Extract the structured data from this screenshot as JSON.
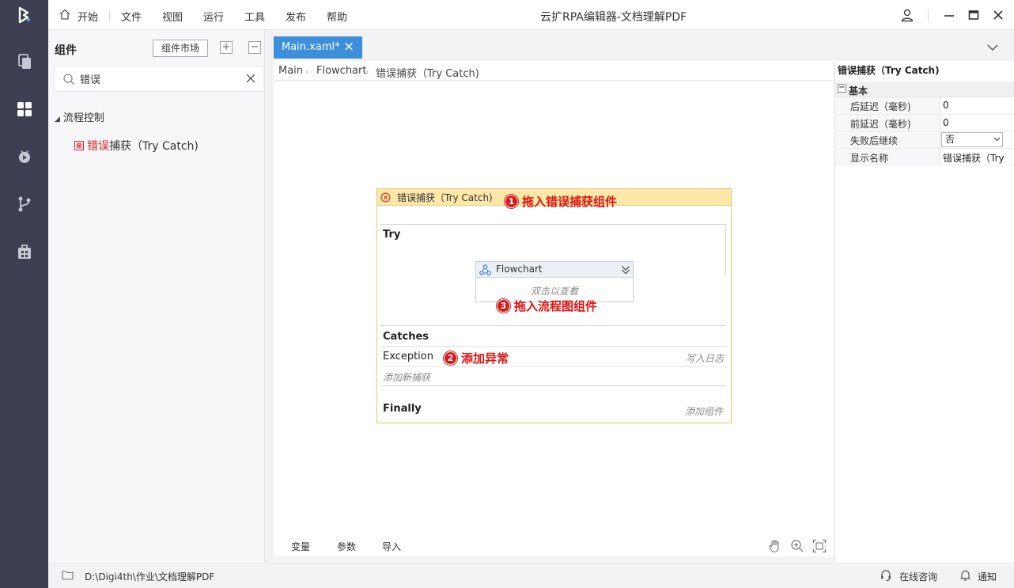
{
  "window": {
    "title": "云扩RPA编辑器-文档理解PDF",
    "menu": [
      "开始",
      "文件",
      "视图",
      "运行",
      "工具",
      "发布",
      "帮助"
    ]
  },
  "rail": {
    "items": [
      "logo-icon",
      "files-icon",
      "components-icon",
      "debug-icon",
      "git-branch-icon",
      "package-icon"
    ]
  },
  "component_panel": {
    "title": "组件",
    "market_button": "组件市场",
    "search_value": "错误",
    "category": "流程控制",
    "item_highlight": "错误",
    "item_rest": "捕获（Try Catch)"
  },
  "tabs": [
    {
      "label": "Main.xaml*"
    }
  ],
  "breadcrumb": [
    "Main",
    "Flowchart",
    "错误捕获（Try Catch)"
  ],
  "designer": {
    "trycatch_title": "错误捕获（Try Catch)",
    "try_label": "Try",
    "flowchart_title": "Flowchart",
    "flowchart_hint": "双击以查看",
    "catches_label": "Catches",
    "exception_label": "Exception",
    "exception_action": "写入日志",
    "add_catch": "添加新捕获",
    "finally_label": "Finally",
    "finally_action": "添加组件",
    "annotations": [
      {
        "num": "1",
        "text": "拖入错误捕获组件"
      },
      {
        "num": "2",
        "text": "添加异常"
      },
      {
        "num": "3",
        "text": "拖入流程图组件"
      }
    ]
  },
  "bottom_tabs": [
    "变量",
    "参数",
    "导入"
  ],
  "properties": {
    "title": "错误捕获（Try Catch)",
    "group": "基本",
    "rows": [
      {
        "key": "后延迟（毫秒)",
        "value": "0"
      },
      {
        "key": "前延迟（毫秒)",
        "value": "0"
      },
      {
        "key": "失败后继续",
        "value": "否"
      },
      {
        "key": "显示名称",
        "value": "错误捕获（Try"
      }
    ]
  },
  "statusbar": {
    "path": "D:\\Digi4th\\作业\\文档理解PDF",
    "consult": "在线咨询",
    "notify": "通知"
  },
  "colors": {
    "rail": "#3e3f52",
    "accent": "#3d8edb",
    "trycatch_header": "#fde8a8",
    "annotation": "#e01010"
  }
}
